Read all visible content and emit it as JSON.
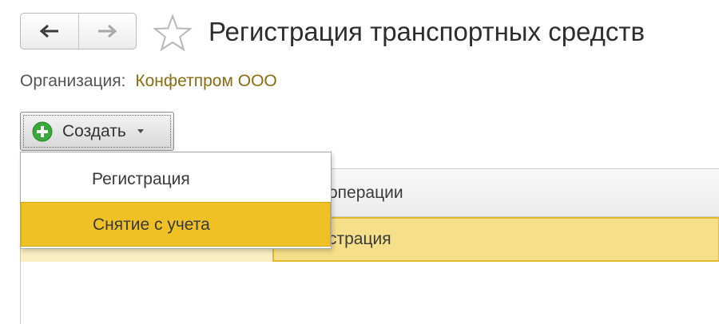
{
  "header": {
    "title": "Регистрация транспортных средств",
    "back_icon": "arrow-left-icon",
    "forward_icon": "arrow-right-icon",
    "favorite_icon": "star-icon"
  },
  "organization": {
    "label": "Организация:",
    "value": "Конфетпром ООО"
  },
  "toolbar": {
    "create_label": "Создать",
    "create_icon": "plus-circle-icon"
  },
  "dropdown": {
    "items": [
      {
        "label": "Регистрация",
        "highlighted": false
      },
      {
        "label": "Снятие с учета",
        "highlighted": true
      }
    ]
  },
  "table": {
    "header_visible": "операции",
    "rows": [
      {
        "cell_visible": "страция",
        "selected": true
      }
    ]
  },
  "colors": {
    "highlight": "#f0c124",
    "selected_row": "#f6df8a",
    "org_value": "#8b6c10",
    "plus_icon": "#3aa83a"
  }
}
